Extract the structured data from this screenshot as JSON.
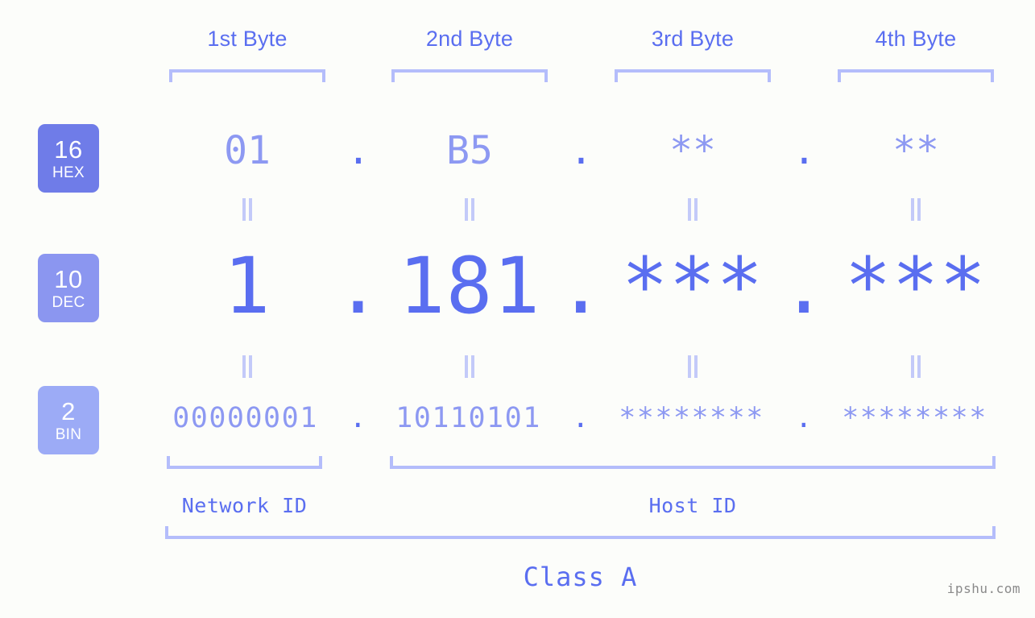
{
  "background_color": "#fcfdfa",
  "accent_color": "#5a6ef0",
  "accent_light_color": "#8d99f2",
  "bracket_color": "#b4bdfb",
  "header": {
    "byte_labels": [
      {
        "label": "1st Byte"
      },
      {
        "label": "2nd Byte"
      },
      {
        "label": "3rd Byte"
      },
      {
        "label": "4th Byte"
      }
    ]
  },
  "rows": [
    {
      "key": "hex",
      "badge": {
        "number": "16",
        "name": "HEX",
        "color": "#6f7ce8"
      },
      "values": [
        "01",
        "B5",
        "**",
        "**"
      ],
      "separators": [
        ".",
        ".",
        "."
      ]
    },
    {
      "key": "dec",
      "badge": {
        "number": "10",
        "name": "DEC",
        "color": "#8b96f0"
      },
      "values": [
        "1",
        "181",
        "***",
        "***"
      ],
      "separators": [
        ".",
        ".",
        "."
      ]
    },
    {
      "key": "bin",
      "badge": {
        "number": "2",
        "name": "BIN",
        "color": "#9cabf6"
      },
      "values": [
        "00000001",
        "10110101",
        "********",
        "********"
      ],
      "separators": [
        ".",
        ".",
        "."
      ]
    }
  ],
  "connector_symbol": "||",
  "footer": {
    "network_id_label": "Network ID",
    "host_id_label": "Host ID",
    "class_label": "Class A"
  },
  "watermark": "ipshu.com"
}
